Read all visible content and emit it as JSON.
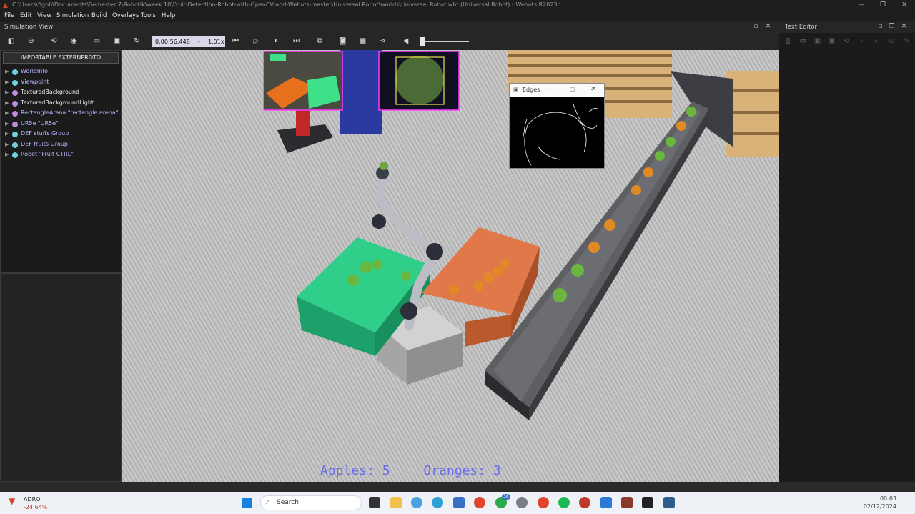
{
  "window": {
    "title": "C:\\Users\\figoh\\Documents\\Semester 7\\Robotik\\week 10\\Fruit-Detection-Robot-with-OpenCV-and-Webots-master\\Universal Robot\\worlds\\Universal Robot.wbt (Universal Robot) - Webots R2023b"
  },
  "menu": [
    "File",
    "Edit",
    "View",
    "Simulation",
    "Build",
    "Overlays",
    "Tools",
    "Help"
  ],
  "panels": {
    "simulation_view": "Simulation View",
    "text_editor": "Text Editor"
  },
  "toolbar": {
    "time": "0:00:56:448",
    "speed_minus": "-",
    "speed": "1.01x"
  },
  "scene_tree": {
    "proto_button": "IMPORTABLE EXTERNPROTO",
    "nodes": [
      {
        "label": "WorldInfo",
        "color": "#6fd0e0"
      },
      {
        "label": "Viewpoint",
        "color": "#6fd0e0"
      },
      {
        "label": "TexturedBackground",
        "color": "#c08ae0"
      },
      {
        "label": "TexturedBackgroundLight",
        "color": "#c08ae0"
      },
      {
        "label": "RectangleArena \"rectangle arena\"",
        "color": "#c08ae0"
      },
      {
        "label": "UR5e \"UR5e\"",
        "color": "#c08ae0"
      },
      {
        "label": "DEF stuffs Group",
        "color": "#6fd0e0"
      },
      {
        "label": "DEF fruits Group",
        "color": "#6fd0e0"
      },
      {
        "label": "Robot \"Fruit CTRL\"",
        "color": "#6fd0e0"
      }
    ]
  },
  "edges_window": {
    "title": "Edges"
  },
  "hud": {
    "apples": "Apples: 5",
    "oranges": "Oranges: 3"
  },
  "taskbar": {
    "stock": {
      "ticker": "ADRO",
      "change": "-24,64%"
    },
    "search_placeholder": "Search",
    "notification_badge": "38",
    "time": "00:03",
    "date": "02/12/2024"
  }
}
